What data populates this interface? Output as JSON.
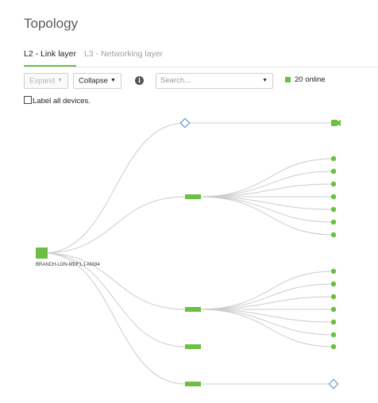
{
  "page": {
    "title": "Topology"
  },
  "tabs": [
    {
      "label": "L2 - Link layer",
      "active": true
    },
    {
      "label": "L3 - Networking layer",
      "active": false
    }
  ],
  "toolbar": {
    "expand_label": "Expand",
    "collapse_label": "Collapse",
    "info_icon": "info-icon",
    "search_placeholder": "Search...",
    "online_text": "20 online"
  },
  "options": {
    "label_all_text": "Label all devices."
  },
  "topology": {
    "root_label": "BRANCH-LON-MDF1.1-MX84",
    "colors": {
      "node": "#6cbf43",
      "link": "#cccccc",
      "diamond": "#4a86c5"
    }
  }
}
